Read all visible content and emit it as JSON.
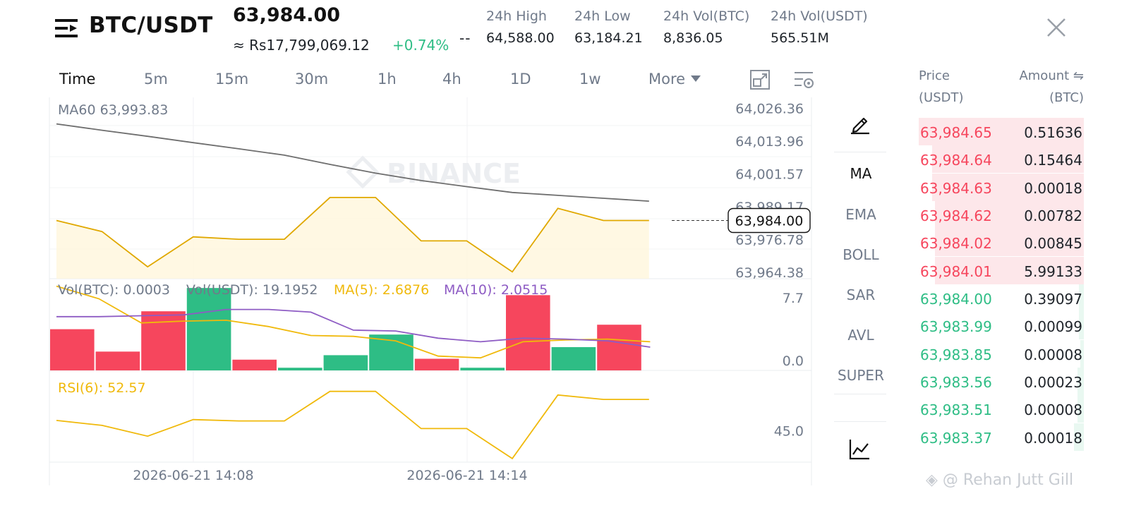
{
  "header": {
    "pair": "BTC/USDT",
    "last_price": "63,984.00",
    "fiat_price": "≈ Rs17,799,069.12",
    "change_pct": "+0.74%",
    "dash": "--",
    "stats": [
      {
        "label": "24h High",
        "value": "64,588.00"
      },
      {
        "label": "24h Low",
        "value": "63,184.21"
      },
      {
        "label": "24h Vol(BTC)",
        "value": "8,836.05"
      },
      {
        "label": "24h Vol(USDT)",
        "value": "565.51M"
      }
    ],
    "icons": {
      "menu": "menu-icon",
      "close": "close-icon"
    }
  },
  "timeframes": [
    {
      "label": "Time",
      "active": true
    },
    {
      "label": "5m"
    },
    {
      "label": "15m"
    },
    {
      "label": "30m"
    },
    {
      "label": "1h"
    },
    {
      "label": "4h"
    },
    {
      "label": "1D"
    },
    {
      "label": "1w"
    },
    {
      "label": "More"
    }
  ],
  "toolbar_icons": [
    "fullscreen-icon",
    "chart-settings-icon"
  ],
  "indicators": {
    "draw_icon": "pencil-icon",
    "items": [
      {
        "label": "MA",
        "active": true
      },
      {
        "label": "EMA"
      },
      {
        "label": "BOLL"
      },
      {
        "label": "SAR"
      },
      {
        "label": "AVL"
      },
      {
        "label": "SUPER"
      }
    ],
    "bottom_icon": "line-chart-icon"
  },
  "orderbook": {
    "price_header": [
      "Price",
      "(USDT)"
    ],
    "amount_header": [
      "Amount ⇋",
      "(BTC)"
    ],
    "asks": [
      {
        "price": "63,984.65",
        "amount": "0.51636",
        "depth": 1.0
      },
      {
        "price": "63,984.64",
        "amount": "0.15464",
        "depth": 0.92
      },
      {
        "price": "63,984.63",
        "amount": "0.00018",
        "depth": 0.92
      },
      {
        "price": "63,984.62",
        "amount": "0.00782",
        "depth": 0.9
      },
      {
        "price": "63,984.02",
        "amount": "0.00845",
        "depth": 0.9
      },
      {
        "price": "63,984.01",
        "amount": "5.99133",
        "depth": 0.9
      }
    ],
    "bids": [
      {
        "price": "63,984.00",
        "amount": "0.39097",
        "depth": 0.03
      },
      {
        "price": "63,983.99",
        "amount": "0.00099",
        "depth": 0.03
      },
      {
        "price": "63,983.85",
        "amount": "0.00008",
        "depth": 0.02
      },
      {
        "price": "63,983.56",
        "amount": "0.00023",
        "depth": 0.04
      },
      {
        "price": "63,983.51",
        "amount": "0.00008",
        "depth": 0.04
      },
      {
        "price": "63,983.37",
        "amount": "0.00018",
        "depth": 0.06
      }
    ]
  },
  "watermark": "@ Rehan Jutt Gill",
  "colors": {
    "up": "#2ebd85",
    "down": "#f6465d",
    "ma60": "#6e6e6e",
    "price_line": "#e0a800",
    "ma5": "#f0b90b",
    "ma10": "#8e5cc4",
    "rsi": "#f0b90b"
  },
  "chart_data": {
    "type": "line",
    "watermark": "BINANCE",
    "x_tick_labels": [
      "2026-06-21 14:08",
      "2026-06-21 14:14"
    ],
    "x_tick_index": [
      3,
      9
    ],
    "price": {
      "ma60_label": "MA60 63,993.83",
      "ylim": [
        63962.0,
        64030.0
      ],
      "y_ticks": [
        "64,026.36",
        "64,013.96",
        "64,001.57",
        "63,989.17",
        "63,976.78",
        "63,964.38"
      ],
      "y_tick_values": [
        64026.36,
        64013.96,
        64001.57,
        63989.17,
        63976.78,
        63964.38
      ],
      "current_price": "63,984.00",
      "current_value": 63984.0,
      "series": [
        {
          "kind": "price",
          "values": [
            63984.0,
            63979.8,
            63966.5,
            63977.8,
            63976.9,
            63976.9,
            63992.7,
            63992.7,
            63976.3,
            63976.3,
            63964.6,
            63988.6,
            63984.0,
            63984.0
          ]
        },
        {
          "kind": "ma60",
          "values": [
            64020.5,
            64018.1,
            64015.8,
            64013.4,
            64011.1,
            64008.7,
            64005.2,
            64001.9,
            63999.1,
            63996.8,
            63994.6,
            63993.5,
            63992.4,
            63991.3
          ]
        }
      ]
    },
    "volume": {
      "labels": {
        "vol_btc": "Vol(BTC): 0.0003",
        "vol_usdt": "Vol(USDT): 19.1952",
        "ma5": "MA(5): 2.6876",
        "ma10": "MA(10): 2.0515"
      },
      "ylim": [
        0,
        10.0
      ],
      "y_ticks": [
        "7.7",
        "0.0"
      ],
      "y_tick_values": [
        7.7,
        0.0
      ],
      "bars": [
        {
          "v": 4.6,
          "dir": "down"
        },
        {
          "v": 2.1,
          "dir": "down"
        },
        {
          "v": 6.6,
          "dir": "down"
        },
        {
          "v": 9.2,
          "dir": "up"
        },
        {
          "v": 1.2,
          "dir": "down"
        },
        {
          "v": 0.3,
          "dir": "up"
        },
        {
          "v": 1.7,
          "dir": "up"
        },
        {
          "v": 4.0,
          "dir": "up"
        },
        {
          "v": 1.3,
          "dir": "down"
        },
        {
          "v": 0.3,
          "dir": "up"
        },
        {
          "v": 8.4,
          "dir": "down"
        },
        {
          "v": 2.6,
          "dir": "up"
        },
        {
          "v": 5.1,
          "dir": "down"
        }
      ],
      "ma5": [
        9.4,
        8.0,
        5.3,
        5.5,
        5.6,
        4.9,
        3.9,
        3.8,
        3.3,
        1.6,
        1.4,
        3.2,
        3.4,
        3.5,
        3.2
      ],
      "ma10": [
        6.0,
        6.0,
        6.1,
        6.2,
        6.8,
        6.8,
        6.5,
        4.5,
        4.4,
        3.6,
        3.2,
        3.6,
        3.5,
        3.3,
        2.6
      ]
    },
    "rsi": {
      "label": "RSI(6): 52.57",
      "ylim": [
        38.0,
        58.0
      ],
      "y_ticks": [
        "45.0"
      ],
      "y_tick_values": [
        45.0
      ],
      "values": [
        47.3,
        46.2,
        43.8,
        47.5,
        47.2,
        47.2,
        53.8,
        53.8,
        45.5,
        45.5,
        38.8,
        53.0,
        52.0,
        52.0
      ]
    }
  }
}
